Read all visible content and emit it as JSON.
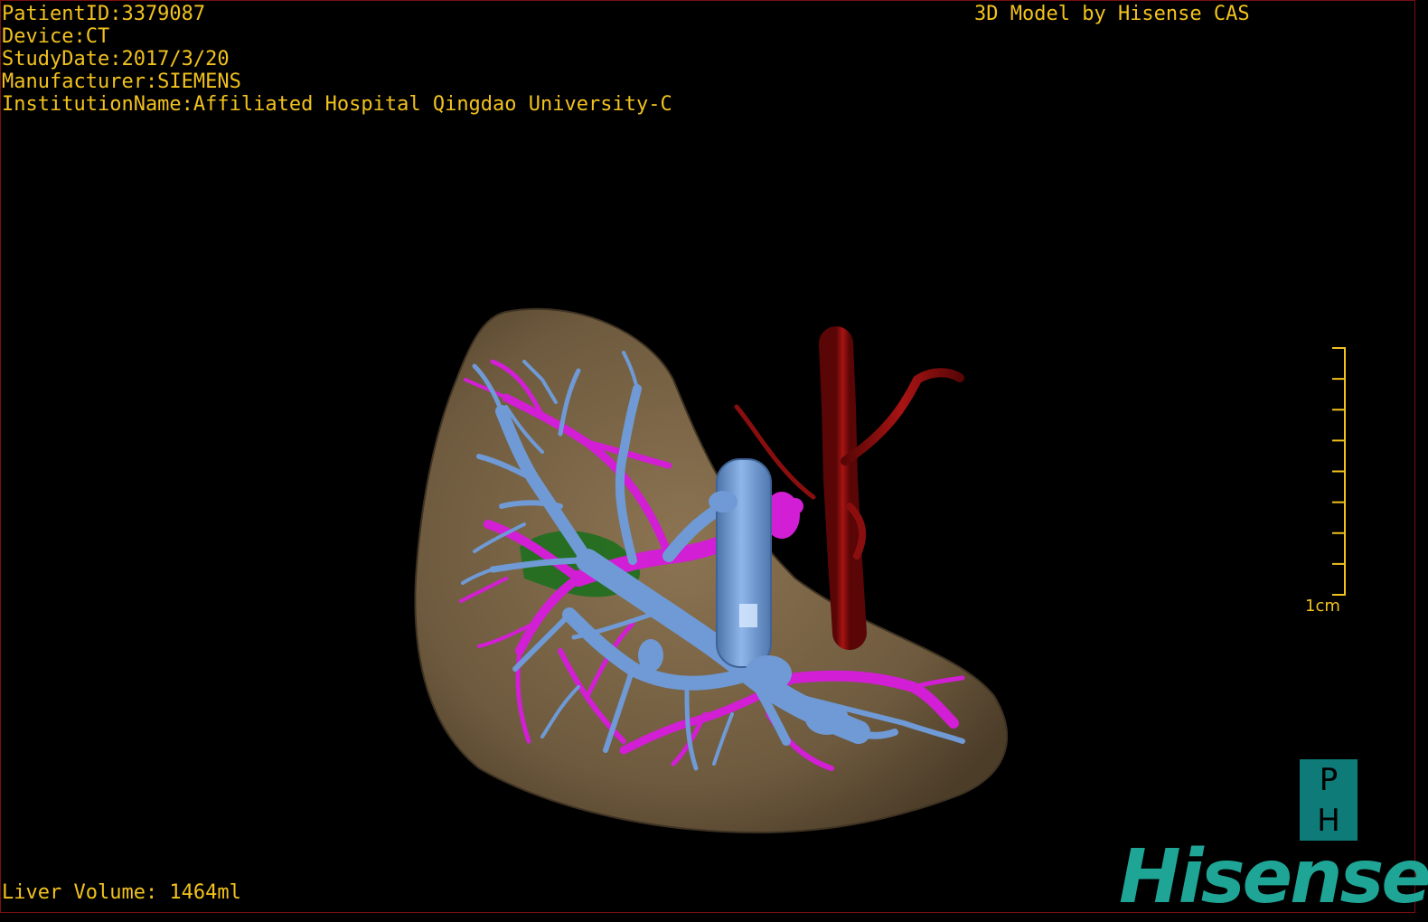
{
  "header": {
    "patient_id": "PatientID:3379087",
    "device": "Device:CT",
    "study_date": "StudyDate:2017/3/20",
    "manufacturer": "Manufacturer:SIEMENS",
    "institution": "InstitutionName:Affiliated Hospital Qingdao University-C"
  },
  "credit": "3D Model by Hisense CAS",
  "footer": {
    "liver_volume": "Liver Volume: 1464ml"
  },
  "scale_bar": {
    "label": "1cm",
    "ticks": 9
  },
  "orientation": {
    "top": "P",
    "bottom": "H"
  },
  "brand": "Hisense",
  "colors": {
    "text": "#f2c21e",
    "liver": "#7a6446",
    "portal_vein": "#6f9ad6",
    "hepatic_vein": "#d020d0",
    "artery": "#8a0e0e",
    "biliary": "#1e7a1e",
    "brand": "#1fa596"
  },
  "icons": [
    "orientation-cube-icon",
    "hisense-logo"
  ]
}
